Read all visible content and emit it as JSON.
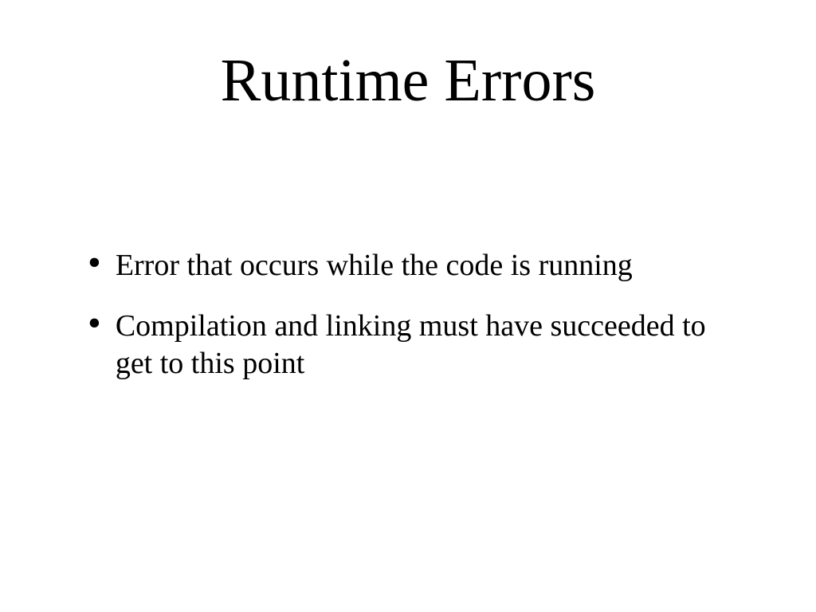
{
  "slide": {
    "title": "Runtime Errors",
    "bullets": [
      "Error that occurs while the code is running",
      "Compilation and linking must have succeeded to get to this point"
    ]
  }
}
